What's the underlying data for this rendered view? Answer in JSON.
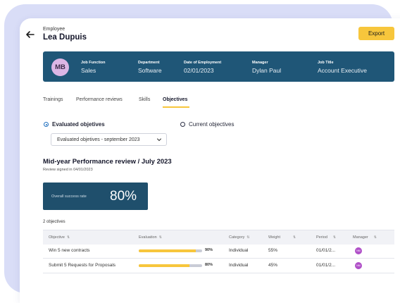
{
  "header": {
    "employee_label": "Employee",
    "employee_name": "Lea Dupuis",
    "export_label": "Export"
  },
  "profile": {
    "initials": "MB",
    "fields": [
      {
        "label": "Job Function",
        "value": "Sales"
      },
      {
        "label": "Department",
        "value": "Software"
      },
      {
        "label": "Date of Employment",
        "value": "02/01/2023"
      },
      {
        "label": "Manager",
        "value": "Dylan Paul"
      },
      {
        "label": "Job Title",
        "value": "Account Executive"
      }
    ]
  },
  "tabs": [
    {
      "label": "Trainings",
      "active": false
    },
    {
      "label": "Performance reviews",
      "active": false
    },
    {
      "label": "Skills",
      "active": false
    },
    {
      "label": "Objectives",
      "active": true
    }
  ],
  "filters": {
    "evaluated_label": "Evaluated objetives",
    "current_label": "Current objectives",
    "selected": "evaluated",
    "select_value": "Evaluated objetives - september 2023"
  },
  "review": {
    "title": "Mid-year Performance review / July 2023",
    "signed": "Review signed in 04/01/2023",
    "score_label": "Overall success rate",
    "score_value": "80%"
  },
  "objectives": {
    "count_label": "2 objectives",
    "columns": [
      "Objective",
      "Evaluation",
      "Category",
      "Weight",
      "Period",
      "Manager"
    ],
    "rows": [
      {
        "objective": "Win 5 new contracts",
        "evaluation": 0.9,
        "evaluation_label": "90%",
        "category": "Individual",
        "weight": "55%",
        "period": "01/01/2...",
        "manager": "NM"
      },
      {
        "objective": "Submit 5 Requests for Proposals",
        "evaluation": 0.8,
        "evaluation_label": "80%",
        "category": "Individual",
        "weight": "45%",
        "period": "01/01/2...",
        "manager": "NM"
      }
    ]
  },
  "colors": {
    "accent": "#f7c63c",
    "banner": "#1f5677",
    "score_box": "#1f4f6c",
    "background_tint": "#d9ddf7"
  }
}
